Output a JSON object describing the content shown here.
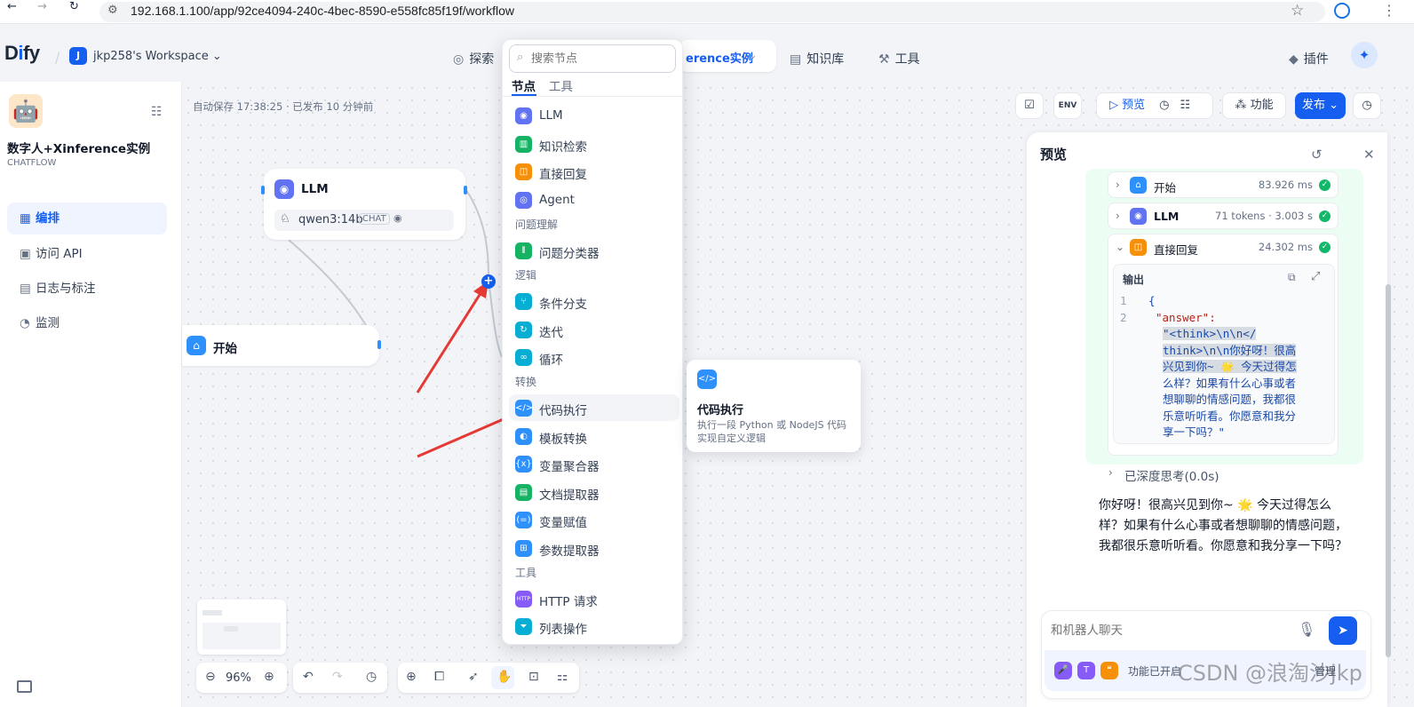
{
  "browser": {
    "url": "192.168.1.100/app/92ce4094-240c-4bec-8590-e558fc85f19f/workflow"
  },
  "header": {
    "logo": "Dify",
    "workspace_initial": "J",
    "workspace_name": "jkp258's Workspace",
    "nav": {
      "explore": "探索",
      "studio_partial": "erence实例",
      "knowledge": "知识库",
      "tools": "工具",
      "plugins": "插件"
    }
  },
  "sidebar": {
    "app_name": "数字人+Xinference实例",
    "app_mode": "CHATFLOW",
    "items": [
      {
        "label": "编排",
        "icon": "layout-icon"
      },
      {
        "label": "访问 API",
        "icon": "terminal-icon"
      },
      {
        "label": "日志与标注",
        "icon": "file-list-icon"
      },
      {
        "label": "监测",
        "icon": "dashboard-icon"
      }
    ]
  },
  "canvas": {
    "autosave": "自动保存 17:38:25 · 已发布 10 分钟前",
    "llm_node": {
      "title": "LLM",
      "model": "qwen3:14b",
      "mode_badge": "CHAT"
    },
    "start_node": {
      "title": "开始"
    },
    "zoom": "96%"
  },
  "toolbar": {
    "env": "ENV",
    "preview": "预览",
    "features": "功能",
    "publish": "发布"
  },
  "node_picker": {
    "search_placeholder": "搜索节点",
    "tabs": [
      "节点",
      "工具"
    ],
    "top_items": [
      {
        "label": "LLM",
        "color": "#6172f3"
      },
      {
        "label": "知识检索",
        "color": "#16b364"
      },
      {
        "label": "直接回复",
        "color": "#f79009"
      },
      {
        "label": "Agent",
        "color": "#6172f3"
      }
    ],
    "section_qa": "问题理解",
    "qa_items": [
      {
        "label": "问题分类器",
        "color": "#16b364"
      }
    ],
    "section_logic": "逻辑",
    "logic_items": [
      {
        "label": "条件分支",
        "color": "#06aed4"
      },
      {
        "label": "迭代",
        "color": "#06aed4"
      },
      {
        "label": "循环",
        "color": "#06aed4"
      }
    ],
    "section_transform": "转换",
    "transform_items": [
      {
        "label": "代码执行",
        "color": "#2e90fa"
      },
      {
        "label": "模板转换",
        "color": "#2e90fa"
      },
      {
        "label": "变量聚合器",
        "color": "#2e90fa"
      },
      {
        "label": "文档提取器",
        "color": "#16b364"
      },
      {
        "label": "变量赋值",
        "color": "#2e90fa"
      },
      {
        "label": "参数提取器",
        "color": "#2e90fa"
      }
    ],
    "section_tools": "工具",
    "tool_items": [
      {
        "label": "HTTP 请求",
        "color": "#875bf7",
        "icon_text": "HTTP"
      },
      {
        "label": "列表操作",
        "color": "#06aed4"
      }
    ],
    "tooltip": {
      "title": "代码执行",
      "desc": "执行一段 Python 或 NodeJS 代码实现自定义逻辑"
    }
  },
  "preview_panel": {
    "title": "预览",
    "trace": [
      {
        "name": "开始",
        "meta": "83.926 ms"
      },
      {
        "name": "LLM",
        "meta": "71 tokens · 3.003 s"
      },
      {
        "name": "直接回复",
        "meta": "24.302 ms"
      }
    ],
    "output_label": "输出",
    "code_lines": [
      "{",
      "\"answer\":",
      "\"<think>\\n\\n</",
      "think>\\n\\n你好呀！很高",
      "兴见到你~ 🌟 今天过得怎",
      "么样？如果有什么心事或者",
      "想聊聊的情感问题，我都很",
      "乐意听听看。你愿意和我分",
      "享一下吗？\""
    ],
    "thinking": "已深度思考(0.0s)",
    "answer": "你好呀！很高兴见到你~ 🌟 今天过得怎么样？如果有什么心事或者想聊聊的情感问题，我都很乐意听听看。你愿意和我分享一下吗？",
    "chat_placeholder": "和机器人聊天",
    "features_enabled": "功能已开启",
    "features_manage": "管理"
  },
  "watermark": "CSDN @浪淘沙jkp"
}
